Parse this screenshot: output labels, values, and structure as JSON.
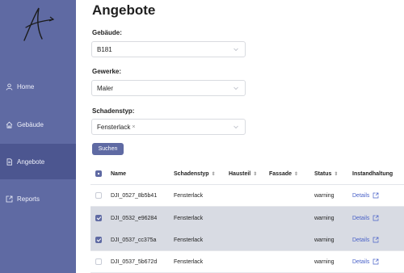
{
  "sidebar": {
    "items": [
      {
        "label": "Home",
        "icon": "user-icon"
      },
      {
        "label": "Gebäude",
        "icon": "home-icon"
      },
      {
        "label": "Angebote",
        "icon": "document-icon",
        "active": true
      },
      {
        "label": "Reports",
        "icon": "external-link-icon"
      }
    ]
  },
  "main": {
    "title": "Angebote",
    "filters": {
      "gebaeude_label": "Gebäude:",
      "gebaeude_value": "B181",
      "gewerke_label": "Gewerke:",
      "gewerke_value": "Maler",
      "schadenstyp_label": "Schadenstyp:",
      "schadenstyp_tag": "Fensterlack",
      "schadenstyp_tag_remove": "×"
    },
    "search_button": "Suchen",
    "table": {
      "headers": {
        "name": "Name",
        "schadenstyp": "Schadenstyp",
        "hausteil": "Hausteil",
        "fassade": "Fassade",
        "status": "Status",
        "instandhaltung": "Instandhaltung"
      },
      "sort_glyph": "⇕",
      "rows": [
        {
          "name": "DJI_0527_8b5b41",
          "schadenstyp": "Fensterlack",
          "status": "warning",
          "link": "Details",
          "checked": false
        },
        {
          "name": "DJI_0532_e96284",
          "schadenstyp": "Fensterlack",
          "status": "warning",
          "link": "Details",
          "checked": true
        },
        {
          "name": "DJI_0537_cc375a",
          "schadenstyp": "Fensterlack",
          "status": "warning",
          "link": "Details",
          "checked": true
        },
        {
          "name": "DJI_0537_5b672d",
          "schadenstyp": "Fensterlack",
          "status": "warning",
          "link": "Details",
          "checked": false
        }
      ]
    }
  },
  "colors": {
    "sidebar": "#5f6aa3",
    "sidebar_active": "#4c5690",
    "accent": "#5f6aa3",
    "link": "#4a62c8",
    "selected_row": "#d8dbe3"
  }
}
